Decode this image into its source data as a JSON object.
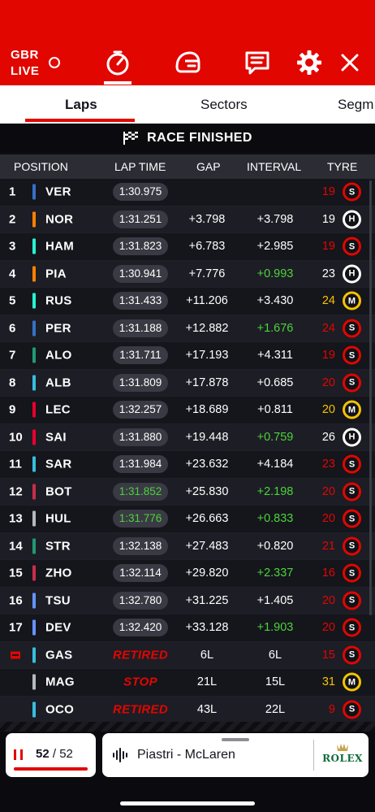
{
  "header": {
    "gbr": "GBR",
    "live": "LIVE",
    "icons": [
      "timer-icon",
      "helmet-icon",
      "radio-message-icon",
      "settings-icon",
      "close-icon"
    ]
  },
  "tabs": [
    {
      "label": "Laps",
      "active": true
    },
    {
      "label": "Sectors",
      "active": false
    },
    {
      "label": "Segm",
      "active": false
    }
  ],
  "banner": {
    "text": "RACE FINISHED"
  },
  "columns": {
    "position": "POSITION",
    "lap_time": "LAP TIME",
    "gap": "GAP",
    "interval": "INTERVAL",
    "tyre": "TYRE"
  },
  "colors": {
    "accent": "#e10600",
    "fastest": "#4cd43a",
    "soft": "#e10600",
    "medium": "#f5c300",
    "hard": "#ffffff"
  },
  "rows": [
    {
      "pos": "1",
      "team_color": "#3671c6",
      "code": "VER",
      "lap": "1:30.975",
      "lap_fast": false,
      "status": "",
      "gap": "",
      "interval": "",
      "interval_green": false,
      "laps": "19",
      "laps_color": "#e10600",
      "tyre": "S"
    },
    {
      "pos": "2",
      "team_color": "#ff8000",
      "code": "NOR",
      "lap": "1:31.251",
      "lap_fast": false,
      "status": "",
      "gap": "+3.798",
      "interval": "+3.798",
      "interval_green": false,
      "laps": "19",
      "laps_color": "#ffffff",
      "tyre": "H"
    },
    {
      "pos": "3",
      "team_color": "#27f4d2",
      "code": "HAM",
      "lap": "1:31.823",
      "lap_fast": false,
      "status": "",
      "gap": "+6.783",
      "interval": "+2.985",
      "interval_green": false,
      "laps": "19",
      "laps_color": "#e10600",
      "tyre": "S"
    },
    {
      "pos": "4",
      "team_color": "#ff8000",
      "code": "PIA",
      "lap": "1:30.941",
      "lap_fast": false,
      "status": "",
      "gap": "+7.776",
      "interval": "+0.993",
      "interval_green": true,
      "laps": "23",
      "laps_color": "#ffffff",
      "tyre": "H"
    },
    {
      "pos": "5",
      "team_color": "#27f4d2",
      "code": "RUS",
      "lap": "1:31.433",
      "lap_fast": false,
      "status": "",
      "gap": "+11.206",
      "interval": "+3.430",
      "interval_green": false,
      "laps": "24",
      "laps_color": "#f5c300",
      "tyre": "M"
    },
    {
      "pos": "6",
      "team_color": "#3671c6",
      "code": "PER",
      "lap": "1:31.188",
      "lap_fast": false,
      "status": "",
      "gap": "+12.882",
      "interval": "+1.676",
      "interval_green": true,
      "laps": "24",
      "laps_color": "#e10600",
      "tyre": "S"
    },
    {
      "pos": "7",
      "team_color": "#229971",
      "code": "ALO",
      "lap": "1:31.711",
      "lap_fast": false,
      "status": "",
      "gap": "+17.193",
      "interval": "+4.311",
      "interval_green": false,
      "laps": "19",
      "laps_color": "#e10600",
      "tyre": "S"
    },
    {
      "pos": "8",
      "team_color": "#37bedd",
      "code": "ALB",
      "lap": "1:31.809",
      "lap_fast": false,
      "status": "",
      "gap": "+17.878",
      "interval": "+0.685",
      "interval_green": false,
      "laps": "20",
      "laps_color": "#e10600",
      "tyre": "S"
    },
    {
      "pos": "9",
      "team_color": "#e8002d",
      "code": "LEC",
      "lap": "1:32.257",
      "lap_fast": false,
      "status": "",
      "gap": "+18.689",
      "interval": "+0.811",
      "interval_green": false,
      "laps": "20",
      "laps_color": "#f5c300",
      "tyre": "M"
    },
    {
      "pos": "10",
      "team_color": "#e8002d",
      "code": "SAI",
      "lap": "1:31.880",
      "lap_fast": false,
      "status": "",
      "gap": "+19.448",
      "interval": "+0.759",
      "interval_green": true,
      "laps": "26",
      "laps_color": "#ffffff",
      "tyre": "H"
    },
    {
      "pos": "11",
      "team_color": "#37bedd",
      "code": "SAR",
      "lap": "1:31.984",
      "lap_fast": false,
      "status": "",
      "gap": "+23.632",
      "interval": "+4.184",
      "interval_green": false,
      "laps": "23",
      "laps_color": "#e10600",
      "tyre": "S"
    },
    {
      "pos": "12",
      "team_color": "#c92d4b",
      "code": "BOT",
      "lap": "1:31.852",
      "lap_fast": true,
      "status": "",
      "gap": "+25.830",
      "interval": "+2.198",
      "interval_green": true,
      "laps": "20",
      "laps_color": "#e10600",
      "tyre": "S"
    },
    {
      "pos": "13",
      "team_color": "#b6babd",
      "code": "HUL",
      "lap": "1:31.776",
      "lap_fast": true,
      "status": "",
      "gap": "+26.663",
      "interval": "+0.833",
      "interval_green": true,
      "laps": "20",
      "laps_color": "#e10600",
      "tyre": "S"
    },
    {
      "pos": "14",
      "team_color": "#229971",
      "code": "STR",
      "lap": "1:32.138",
      "lap_fast": false,
      "status": "",
      "gap": "+27.483",
      "interval": "+0.820",
      "interval_green": false,
      "laps": "21",
      "laps_color": "#e10600",
      "tyre": "S"
    },
    {
      "pos": "15",
      "team_color": "#c92d4b",
      "code": "ZHO",
      "lap": "1:32.114",
      "lap_fast": false,
      "status": "",
      "gap": "+29.820",
      "interval": "+2.337",
      "interval_green": true,
      "laps": "16",
      "laps_color": "#e10600",
      "tyre": "S"
    },
    {
      "pos": "16",
      "team_color": "#6692ff",
      "code": "TSU",
      "lap": "1:32.780",
      "lap_fast": false,
      "status": "",
      "gap": "+31.225",
      "interval": "+1.405",
      "interval_green": false,
      "laps": "20",
      "laps_color": "#e10600",
      "tyre": "S"
    },
    {
      "pos": "17",
      "team_color": "#6692ff",
      "code": "DEV",
      "lap": "1:32.420",
      "lap_fast": false,
      "status": "",
      "gap": "+33.128",
      "interval": "+1.903",
      "interval_green": true,
      "laps": "20",
      "laps_color": "#e10600",
      "tyre": "S"
    },
    {
      "pos": "",
      "pos_icon": "out-icon",
      "team_color": "#37bedd",
      "code": "GAS",
      "lap": "",
      "lap_fast": false,
      "status": "RETIRED",
      "gap": "6L",
      "interval": "6L",
      "interval_green": false,
      "laps": "15",
      "laps_color": "#e10600",
      "tyre": "S"
    },
    {
      "pos": "",
      "team_color": "#b6babd",
      "code": "MAG",
      "lap": "",
      "lap_fast": false,
      "status": "STOP",
      "gap": "21L",
      "interval": "15L",
      "interval_green": false,
      "laps": "31",
      "laps_color": "#f5c300",
      "tyre": "M"
    },
    {
      "pos": "",
      "team_color": "#37bedd",
      "code": "OCO",
      "lap": "",
      "lap_fast": false,
      "status": "RETIRED",
      "gap": "43L",
      "interval": "22L",
      "interval_green": false,
      "laps": "9",
      "laps_color": "#e10600",
      "tyre": "S"
    }
  ],
  "footer": {
    "lap_current": "52",
    "lap_separator": "/",
    "lap_total": "52",
    "lap_progress": 1.0,
    "radio_text": "Piastri - McLaren",
    "sponsor": "ROLEX"
  }
}
